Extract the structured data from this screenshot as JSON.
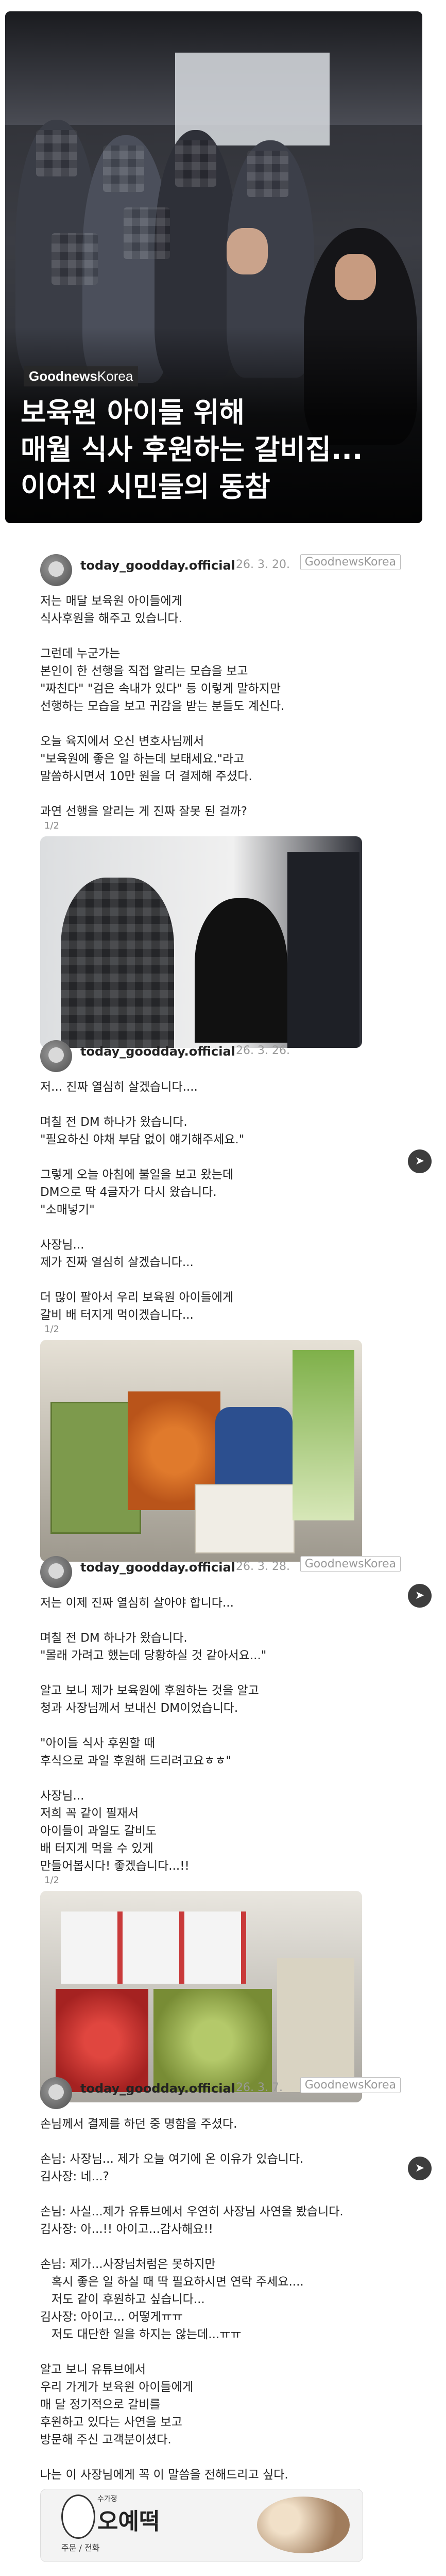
{
  "hero": {
    "brand_bold": "Goodnews",
    "brand_light": "Korea",
    "title_lines": [
      "보육원 아이들 위해",
      "매월 식사 후원하는 갈비집...",
      "이어진 시민들의 동참"
    ]
  },
  "logo": {
    "bold": "Goodnews",
    "light": "Korea"
  },
  "posts": [
    {
      "handle": "today_goodday.official",
      "date": "26. 3. 20.",
      "lines": [
        "저는 매달 보육원 아이들에게",
        "식사후원을 해주고 있습니다.",
        "",
        "그런데 누군가는",
        "본인이 한 선행을 직접 알리는 모습을 보고",
        "\"짜친다\" \"검은 속내가 있다\" 등 이렇게 말하지만",
        "선행하는 모습을 보고 귀감을 받는 분들도 계신다.",
        "",
        "오늘 육지에서 오신 변호사님께서",
        "\"보육원에 좋은 일 하는데 보태세요.\"라고",
        "말씀하시면서 10만 원을 더 결제해 주셨다.",
        "",
        "과연 선행을 알리는 게 진짜 잘못 된 걸까?"
      ],
      "counter": "1/2"
    },
    {
      "handle": "today_goodday.official",
      "date": "26. 3. 26.",
      "lines": [
        "저... 진짜 열심히 살겠습니다....",
        "",
        "며칠 전 DM 하나가 왔습니다.",
        "\"필요하신 야채 부담 없이 얘기해주세요.\"",
        "",
        "그렇게 오늘 아침에 불일을 보고 왔는데",
        "DM으로 딱 4글자가 다시 왔습니다.",
        "\"소매넣기\"",
        "",
        "사장님...",
        "제가 진짜 열심히 살겠습니다...",
        "",
        "더 많이 팔아서 우리 보육원 아이들에게",
        "갈비 배 터지게 먹이겠습니다..."
      ],
      "counter": "1/2"
    },
    {
      "handle": "today_goodday.official",
      "date": "26. 3. 28.",
      "lines": [
        "저는 이제 진짜 열심히 살아야 합니다...",
        "",
        "며칠 전 DM 하나가 왔습니다.",
        "\"몰래 가려고 했는데 당황하실 것 같아서요...\"",
        "",
        "알고 보니 제가 보육원에 후원하는 것을 알고",
        "청과 사장님께서 보내신 DM이었습니다.",
        "",
        "\"아이들 식사 후원할 때",
        "후식으로 과일 후원해 드리려고요ㅎㅎ\"",
        "",
        "사장님...",
        "저희 꼭 같이 필재서",
        "아이들이 과일도 갈비도",
        "배 터지게 먹을 수 있게",
        "만들어봅시다! 좋겠습니다...!!"
      ],
      "counter": "1/2"
    },
    {
      "handle": "today_goodday.official",
      "date": "26. 3. 7.",
      "lines": [
        "손님께서 결제를 하던 중 명함을 주셨다.",
        "",
        "손님: 사장님... 제가 오늘 여기에 온 이유가 있습니다.",
        "김사장: 네...?",
        "",
        "손님: 사실...제가 유튜브에서 우연히 사장님 사연을 봤습니다.",
        "김사장: 아...!! 아이고...감사해요!!",
        "",
        "손님: 제가...사장님처럼은 못하지만",
        "   혹시 좋은 일 하실 때 딱 필요하시면 연락 주세요....",
        "   저도 같이 후원하고 싶습니다...",
        "김사장: 아이고... 어떻게ㅠㅠ",
        "   저도 대단한 일을 하지는 않는데...ㅠㅠ",
        "",
        "알고 보니 유튜브에서",
        "우리 가게가 보육원 아이들에게",
        "매 달 정기적으로 갈비를",
        "후원하고 있다는 사연을 보고",
        "방문해 주신 고객분이셨다.",
        "",
        "나는 이 사장님에게 꼭 이 말씀을 전해드리고 싶다."
      ],
      "card_sign": "수가정",
      "card_name": "오예떡",
      "card_sub": "주문 / 전화"
    }
  ],
  "share_icon": "share-icon"
}
